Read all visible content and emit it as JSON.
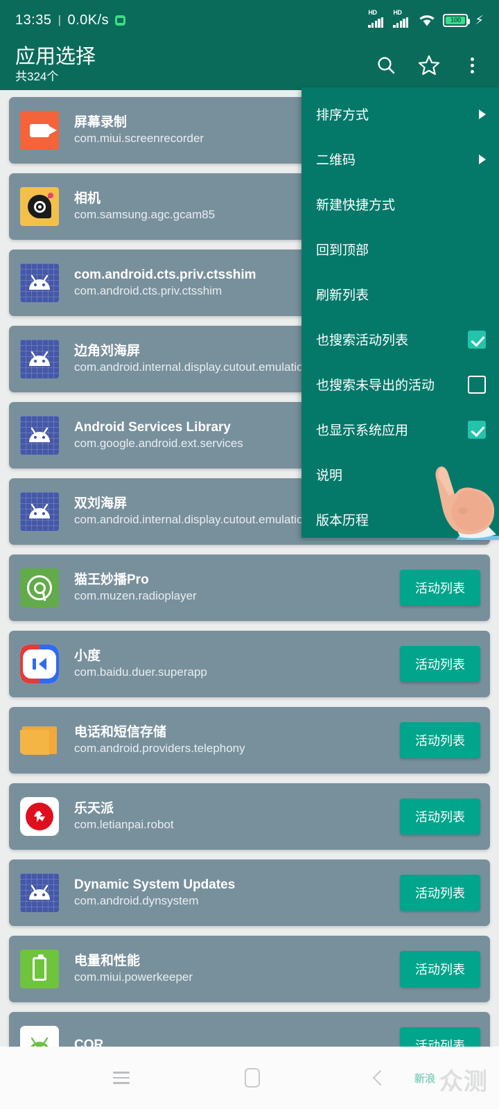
{
  "statusbar": {
    "time": "13:35",
    "separator": "|",
    "netspeed": "0.0K/s",
    "speed_badge_icon": "green-square-icon",
    "signal1_label": "HD",
    "signal2_label": "HD",
    "wifi_icon": "wifi-icon",
    "battery_level": "100",
    "charging_icon": "bolt-icon"
  },
  "appbar": {
    "title": "应用选择",
    "subtitle": "共324个",
    "search_icon": "search-icon",
    "star_icon": "star-icon",
    "overflow_icon": "more-vertical-icon"
  },
  "menu": {
    "items": [
      {
        "label": "排序方式",
        "type": "submenu"
      },
      {
        "label": "二维码",
        "type": "submenu"
      },
      {
        "label": "新建快捷方式",
        "type": "action"
      },
      {
        "label": "回到顶部",
        "type": "action"
      },
      {
        "label": "刷新列表",
        "type": "action"
      },
      {
        "label": "也搜索活动列表",
        "type": "checkbox",
        "checked": true
      },
      {
        "label": "也搜索未导出的活动",
        "type": "checkbox",
        "checked": false
      },
      {
        "label": "也显示系统应用",
        "type": "checkbox",
        "checked": true
      },
      {
        "label": "说明",
        "type": "action"
      },
      {
        "label": "版本历程",
        "type": "action"
      }
    ]
  },
  "apps": [
    {
      "name": "屏幕录制",
      "pkg": "com.miui.screenrecorder",
      "icon": "screen-recorder-icon",
      "button": ""
    },
    {
      "name": "相机",
      "pkg": "com.samsung.agc.gcam85",
      "icon": "gcam-icon",
      "button": ""
    },
    {
      "name": "com.android.cts.priv.ctsshim",
      "pkg": "com.android.cts.priv.ctsshim",
      "icon": "android-robot-icon",
      "button": ""
    },
    {
      "name": "边角刘海屏",
      "pkg": "com.android.internal.display.cutout.emulation.corner",
      "icon": "android-robot-icon",
      "button": ""
    },
    {
      "name": "Android Services Library",
      "pkg": "com.google.android.ext.services",
      "icon": "android-robot-icon",
      "button": ""
    },
    {
      "name": "双刘海屏",
      "pkg": "com.android.internal.display.cutout.emulation.double",
      "icon": "android-robot-icon",
      "button": ""
    },
    {
      "name": "猫王妙播Pro",
      "pkg": "com.muzen.radioplayer",
      "icon": "muzen-icon",
      "button": "活动列表"
    },
    {
      "name": "小度",
      "pkg": "com.baidu.duer.superapp",
      "icon": "duer-icon",
      "button": "活动列表"
    },
    {
      "name": "电话和短信存储",
      "pkg": "com.android.providers.telephony",
      "icon": "folder-icon",
      "button": "活动列表"
    },
    {
      "name": "乐天派",
      "pkg": "com.letianpai.robot",
      "icon": "letianpai-icon",
      "button": "活动列表"
    },
    {
      "name": "Dynamic System Updates",
      "pkg": "com.android.dynsystem",
      "icon": "android-robot-icon",
      "button": "活动列表"
    },
    {
      "name": "电量和性能",
      "pkg": "com.miui.powerkeeper",
      "icon": "battery-perf-icon",
      "button": "活动列表"
    },
    {
      "name": "CQR",
      "pkg": "",
      "icon": "cqr-android-icon",
      "button": "活动列表"
    }
  ],
  "navbar": {
    "recent_icon": "recents-icon",
    "home_icon": "home-icon",
    "back_icon": "back-icon"
  },
  "watermark": {
    "small": "新浪",
    "big": "众测"
  },
  "colors": {
    "appbar": "#0b6b5b",
    "menu_bg": "#04796a",
    "card_bg": "#78909c",
    "accent_button": "#00a58c",
    "checkbox_on": "#23c4ab",
    "page_bg": "#eceded"
  }
}
